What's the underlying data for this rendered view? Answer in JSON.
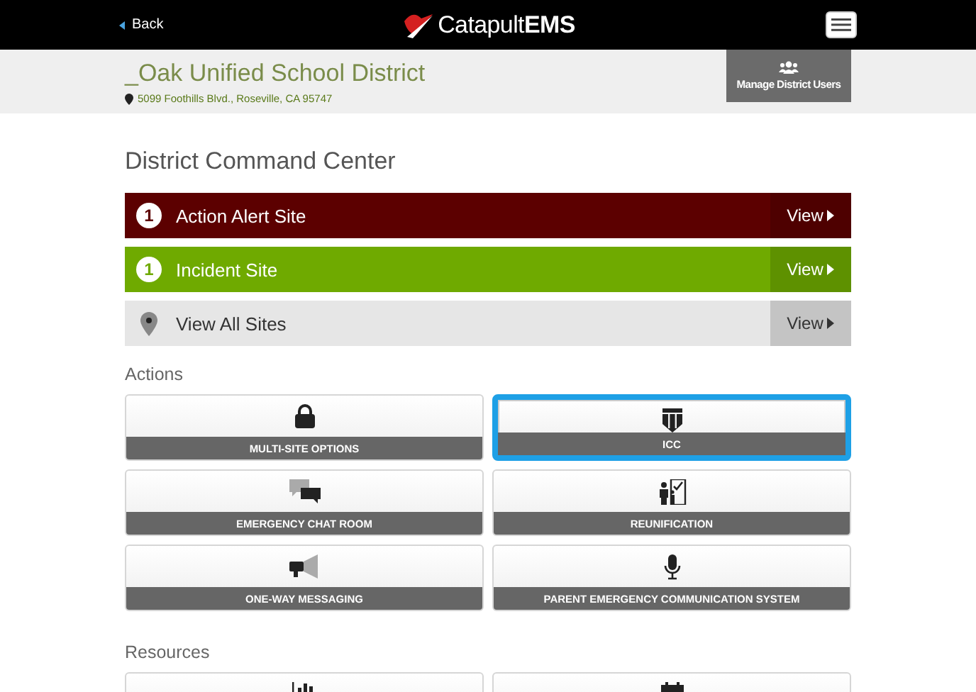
{
  "header": {
    "back": "Back",
    "logo": "Catapult**EMS**"
  },
  "district": {
    "name": "_Oak Unified School District",
    "address": "5099 Foothills Blvd., Roseville, CA 95747",
    "manage_button": "Manage District Users"
  },
  "title": "District Command Center",
  "sites": [
    {
      "kind": "count",
      "count": "1",
      "label": "Action Alert Site",
      "color": "#5c0000",
      "action": "View"
    },
    {
      "kind": "count",
      "count": "1",
      "label": "Incident Site",
      "color": "#6faa00",
      "action": "View"
    },
    {
      "kind": "pin",
      "label": "View All Sites",
      "color": "#e6e6e6",
      "action": "View"
    }
  ],
  "sections": [
    {
      "heading": "Actions",
      "tiles": [
        {
          "kind": "lock",
          "label": "MULTI-SITE OPTIONS",
          "selected": false
        },
        {
          "kind": "shield",
          "label": "ICC",
          "selected": true
        },
        {
          "kind": "chat",
          "label": "EMERGENCY CHAT ROOM",
          "selected": false
        },
        {
          "kind": "reunify",
          "label": "REUNIFICATION",
          "selected": false
        },
        {
          "kind": "megaphone",
          "label": "ONE-WAY MESSAGING",
          "selected": false
        },
        {
          "kind": "mic",
          "label": "PARENT EMERGENCY COMMUNICATION SYSTEM",
          "selected": false
        }
      ]
    },
    {
      "heading": "Resources",
      "tiles": [
        {
          "kind": "chart",
          "selected": false
        },
        {
          "kind": "calendar",
          "selected": false
        }
      ]
    }
  ]
}
